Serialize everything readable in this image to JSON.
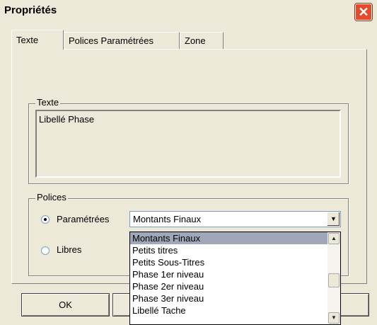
{
  "window": {
    "title": "Propriétés",
    "close_icon": "close-icon"
  },
  "tabs": [
    {
      "label": "Texte",
      "active": true
    },
    {
      "label": "Polices Paramétrées",
      "active": false
    },
    {
      "label": "Zone",
      "active": false
    }
  ],
  "texte_group": {
    "legend": "Texte",
    "value": "Libellé Phase"
  },
  "polices_group": {
    "legend": "Polices",
    "radio_parametrees": {
      "label": "Paramétrées",
      "checked": true
    },
    "radio_libres": {
      "label": "Libres",
      "checked": false
    },
    "combo": {
      "selected": "Montants Finaux"
    }
  },
  "dropdown": {
    "items": [
      "Montants Finaux",
      "Petits titres",
      "Petits Sous-Titres",
      "Phase 1er niveau",
      "Phase 2er niveau",
      "Phase 3er niveau",
      "Libellé Tache"
    ],
    "selected_index": 0
  },
  "buttons": {
    "ok": "OK"
  },
  "colors": {
    "selection": "#9fa7b9",
    "close_button": "#e24c2c",
    "dialog_bg": "#ece9d8"
  }
}
